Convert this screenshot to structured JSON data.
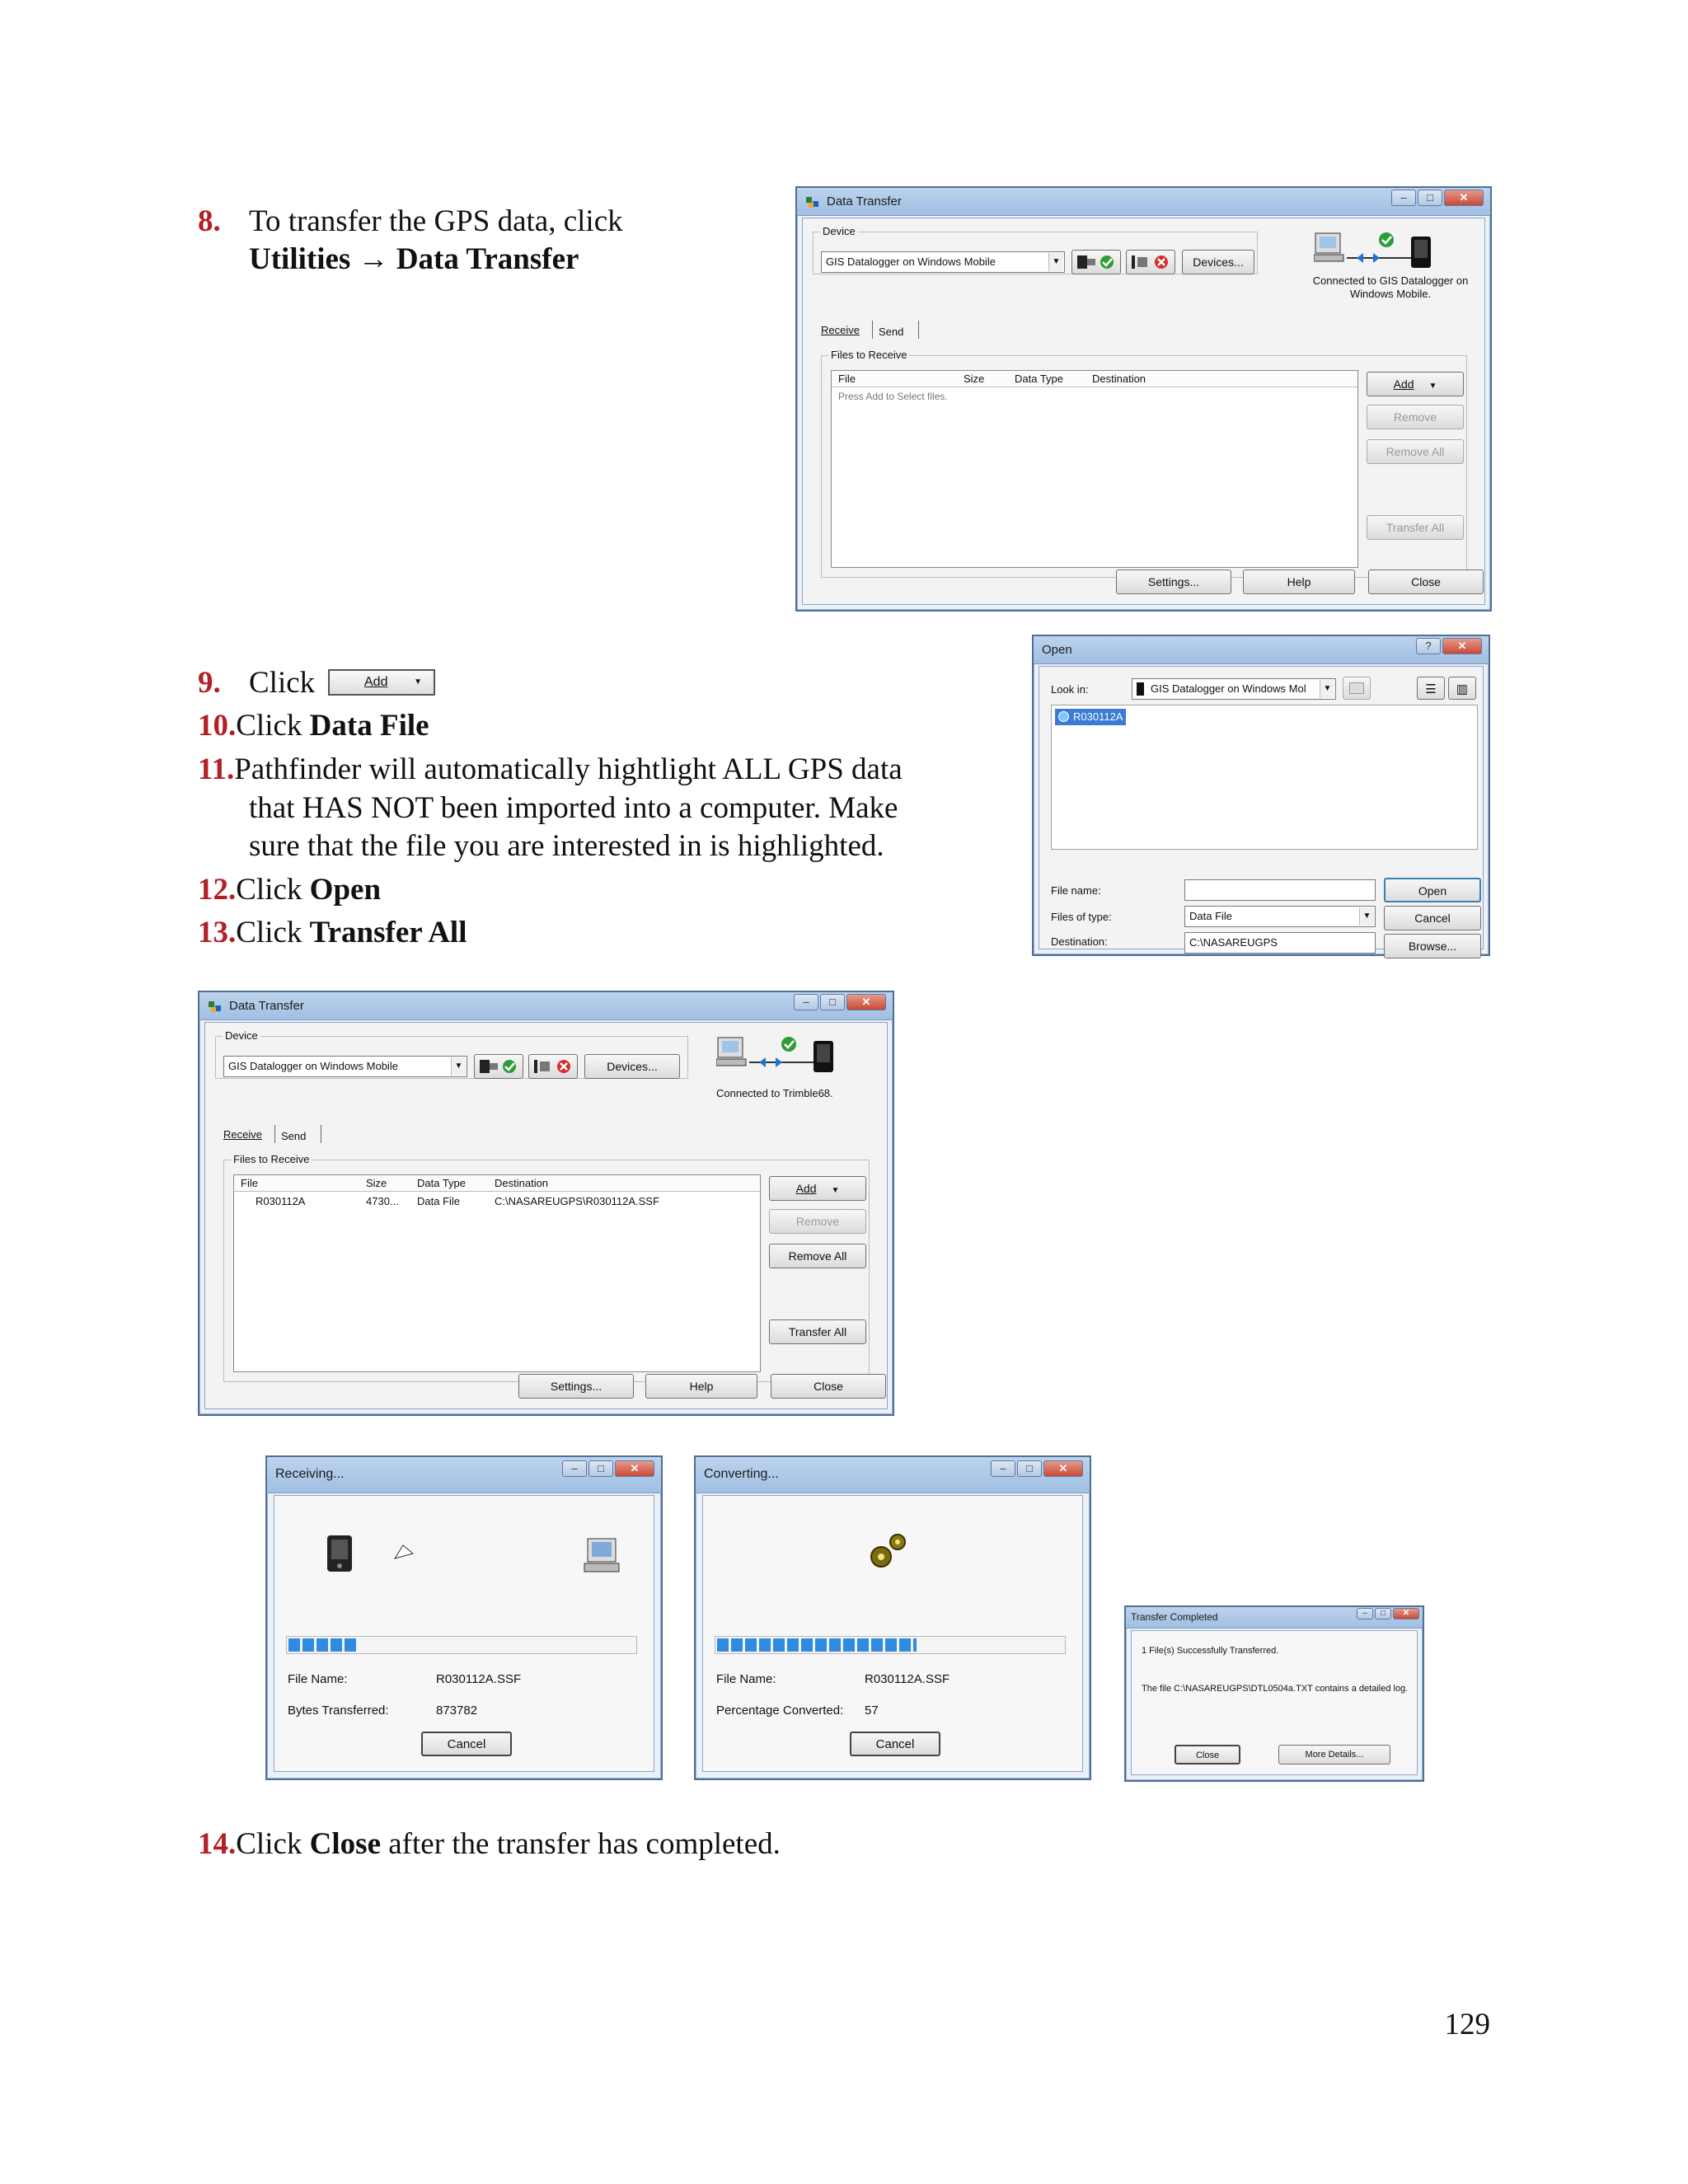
{
  "steps": {
    "s8": {
      "num": "8.",
      "line1": "To transfer the GPS data, click",
      "b1": "Utilities",
      "arrow": "→",
      "b2": "Data Transfer"
    },
    "s9": {
      "num": "9.",
      "text": "Click",
      "button": "Add"
    },
    "s10": {
      "num": "10.",
      "text": "Click ",
      "bold": "Data File"
    },
    "s11": {
      "num": "11.",
      "line1": "Pathfinder will automatically hightlight ALL GPS data",
      "line2": "that HAS NOT been imported into a computer. Make",
      "line3": "sure that the file you are interested in is highlighted."
    },
    "s12": {
      "num": "12.",
      "text": "Click ",
      "bold": "Open"
    },
    "s13": {
      "num": "13.",
      "text": "Click ",
      "bold": "Transfer All"
    },
    "s14": {
      "num": "14.",
      "text": "Click ",
      "bold": "Close",
      "rest": " after the transfer has completed."
    }
  },
  "page_number": "129",
  "dt1": {
    "title": "Data Transfer",
    "device_group": "Device",
    "device_value": "GIS Datalogger on Windows Mobile",
    "devices_btn": "Devices...",
    "status": "Connected to GIS Datalogger on Windows Mobile.",
    "tab_receive": "Receive",
    "tab_send": "Send",
    "files_group": "Files to Receive",
    "col_file": "File",
    "col_size": "Size",
    "col_type": "Data Type",
    "col_dest": "Destination",
    "empty_hint": "Press Add to Select files.",
    "add": "Add",
    "remove": "Remove",
    "remove_all": "Remove All",
    "transfer_all": "Transfer All",
    "settings": "Settings...",
    "help": "Help",
    "close": "Close"
  },
  "open": {
    "title": "Open",
    "look_in_label": "Look in:",
    "look_in_value": "GIS Datalogger on Windows Mol",
    "file_item": "R030112A",
    "file_name_label": "File name:",
    "file_name_value": "",
    "files_of_type_label": "Files of type:",
    "files_of_type_value": "Data File",
    "destination_label": "Destination:",
    "destination_value": "C:\\NASAREUGPS",
    "open_btn": "Open",
    "cancel_btn": "Cancel",
    "browse_btn": "Browse..."
  },
  "dt2": {
    "title": "Data Transfer",
    "device_group": "Device",
    "device_value": "GIS Datalogger on Windows Mobile",
    "devices_btn": "Devices...",
    "status": "Connected to Trimble68.",
    "tab_receive": "Receive",
    "tab_send": "Send",
    "files_group": "Files to Receive",
    "col_file": "File",
    "col_size": "Size",
    "col_type": "Data Type",
    "col_dest": "Destination",
    "row": {
      "file": "R030112A",
      "size": "4730...",
      "type": "Data File",
      "dest": "C:\\NASAREUGPS\\R030112A.SSF"
    },
    "add": "Add",
    "remove": "Remove",
    "remove_all": "Remove All",
    "transfer_all": "Transfer All",
    "settings": "Settings...",
    "help": "Help",
    "close": "Close"
  },
  "receiving": {
    "title": "Receiving...",
    "file_name_label": "File Name:",
    "file_name_value": "R030112A.SSF",
    "bytes_label": "Bytes Transferred:",
    "bytes_value": "873782",
    "progress_fraction": 0.2,
    "cancel": "Cancel"
  },
  "converting": {
    "title": "Converting...",
    "file_name_label": "File Name:",
    "file_name_value": "R030112A.SSF",
    "percent_label": "Percentage Converted:",
    "percent_value": "57",
    "progress_fraction": 0.57,
    "cancel": "Cancel"
  },
  "completed": {
    "title": "Transfer Completed",
    "msg1": "1 File(s) Successfully Transferred.",
    "msg2": "The file C:\\NASAREUGPS\\DTL0504a.TXT contains a detailed log.",
    "close": "Close",
    "more": "More Details..."
  }
}
